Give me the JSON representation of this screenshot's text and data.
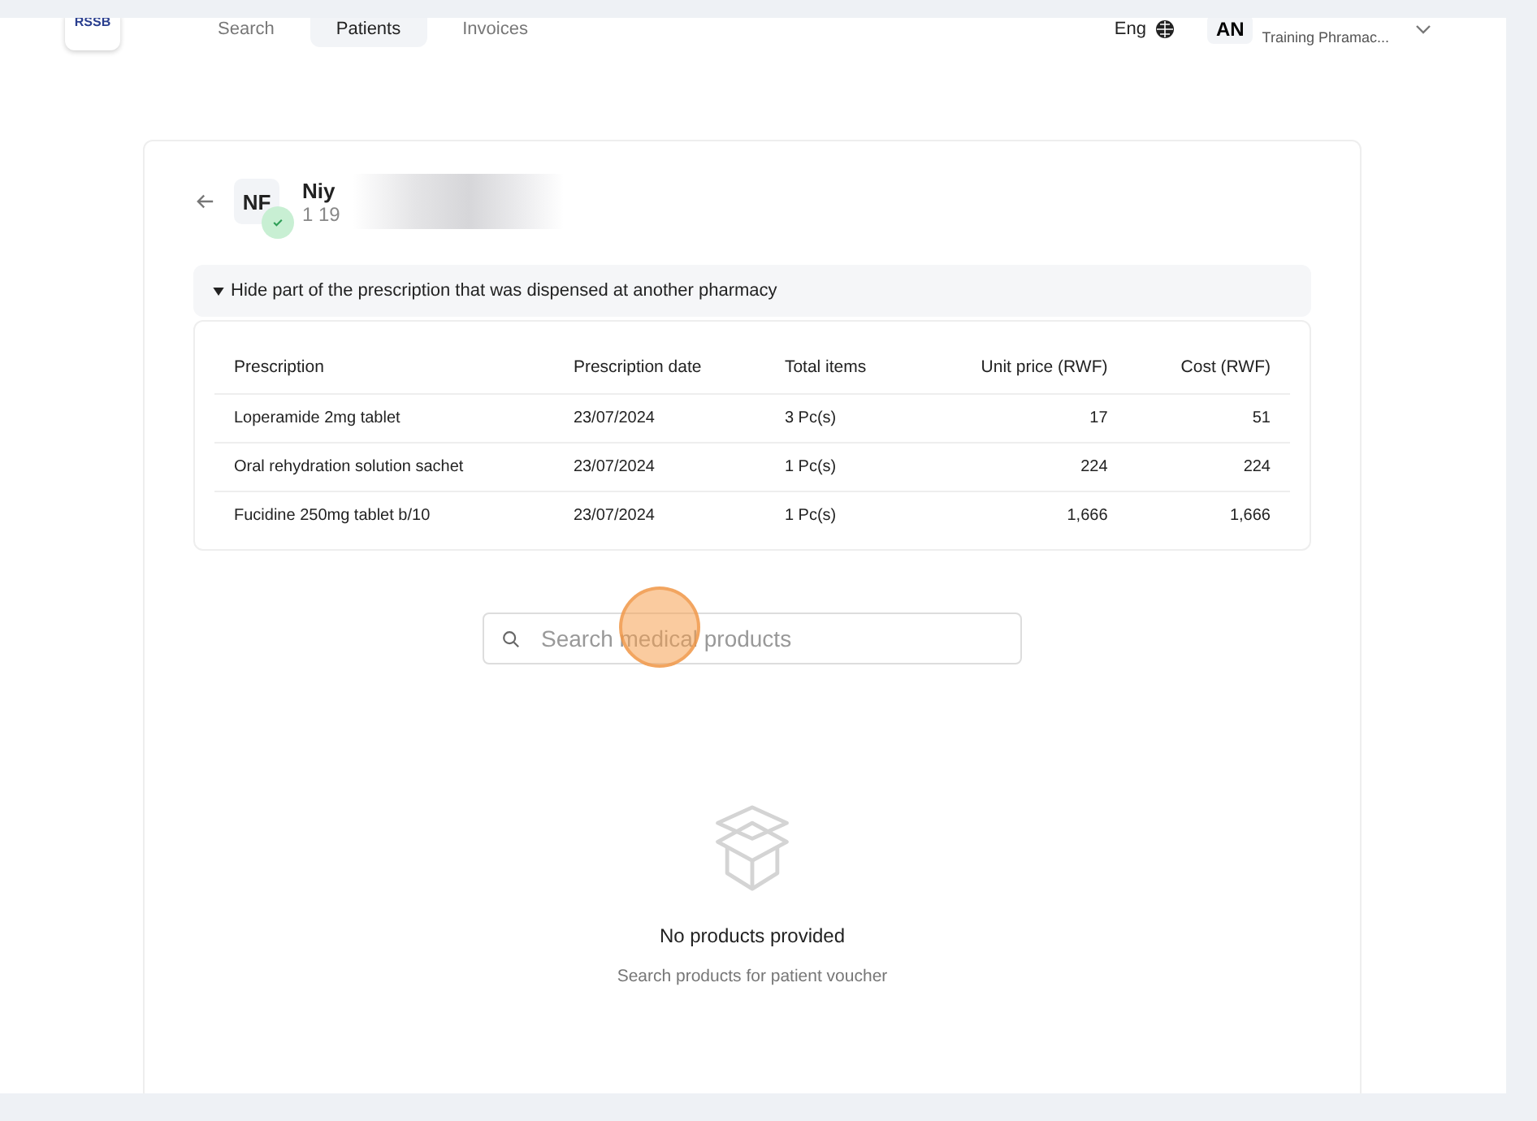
{
  "header": {
    "logo": "RSSB",
    "nav": [
      {
        "label": "Search",
        "selected": false
      },
      {
        "label": "Patients",
        "selected": true
      },
      {
        "label": "Invoices",
        "selected": false
      }
    ],
    "language": "Eng",
    "user": {
      "initials": "AN",
      "pharmacy": "Training Phramac..."
    }
  },
  "patient": {
    "initials": "NF",
    "verified": true,
    "name": "Niy",
    "id_number": "1 19"
  },
  "collapse": {
    "label": "Hide part of the prescription that was dispensed at another pharmacy",
    "expanded": true
  },
  "table": {
    "columns": [
      "Prescription",
      "Prescription date",
      "Total items",
      "Unit price (RWF)",
      "Cost (RWF)"
    ],
    "rows": [
      [
        "Loperamide 2mg tablet",
        "23/07/2024",
        "3 Pc(s)",
        "17",
        "51"
      ],
      [
        "Oral rehydration solution sachet",
        "23/07/2024",
        "1 Pc(s)",
        "224",
        "224"
      ],
      [
        "Fucidine 250mg tablet b/10",
        "23/07/2024",
        "1 Pc(s)",
        "1,666",
        "1,666"
      ]
    ]
  },
  "search": {
    "placeholder": "Search medical products"
  },
  "empty": {
    "title": "No products provided",
    "subtitle": "Search products for patient voucher"
  }
}
